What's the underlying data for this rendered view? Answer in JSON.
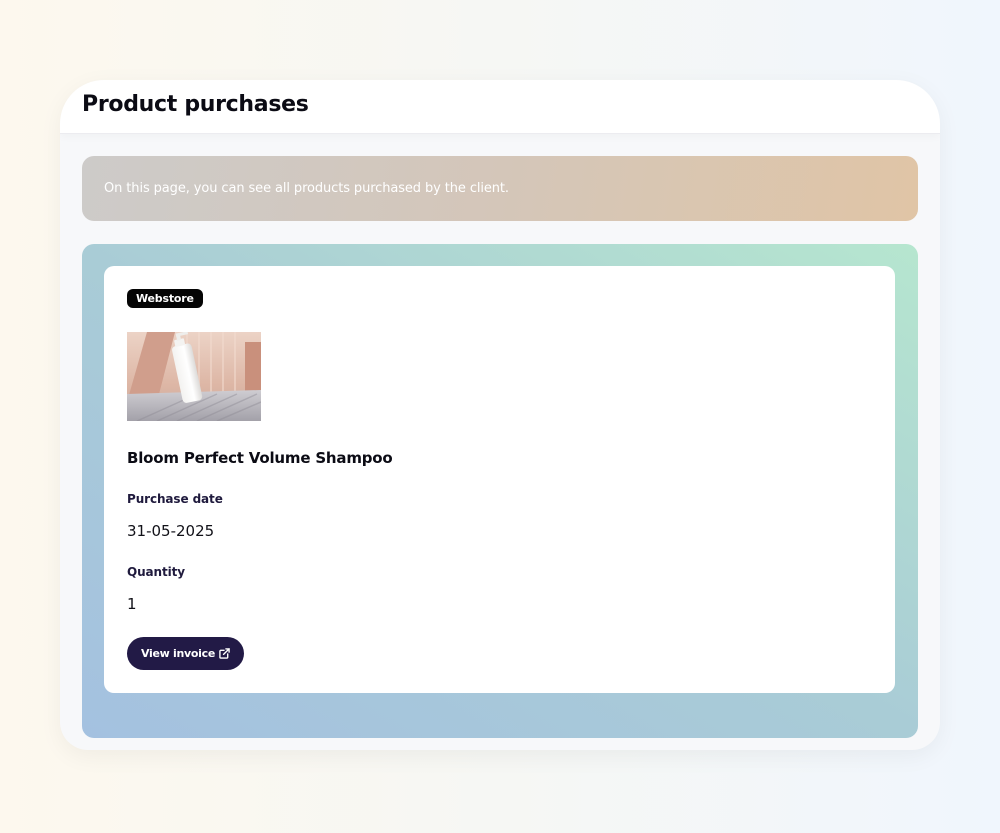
{
  "page": {
    "title": "Product purchases"
  },
  "banner": {
    "text": "On this page, you can see all products purchased by the client."
  },
  "purchases": [
    {
      "source_badge": "Webstore",
      "image_alt": "Bloom Perfect Volume Shampoo bottle",
      "name": "Bloom Perfect Volume Shampoo",
      "purchase_date_label": "Purchase date",
      "purchase_date": "31-05-2025",
      "quantity_label": "Quantity",
      "quantity": "1",
      "invoice_button_label": "View invoice",
      "invoice_icon": "external-link-icon"
    }
  ],
  "colors": {
    "button_bg": "#221a46",
    "badge_bg": "#050505",
    "banner_gradient": [
      "#cdcbc9",
      "#e0c5a6"
    ],
    "products_gradient": [
      "#a4c1e0",
      "#b6e6cf"
    ]
  }
}
